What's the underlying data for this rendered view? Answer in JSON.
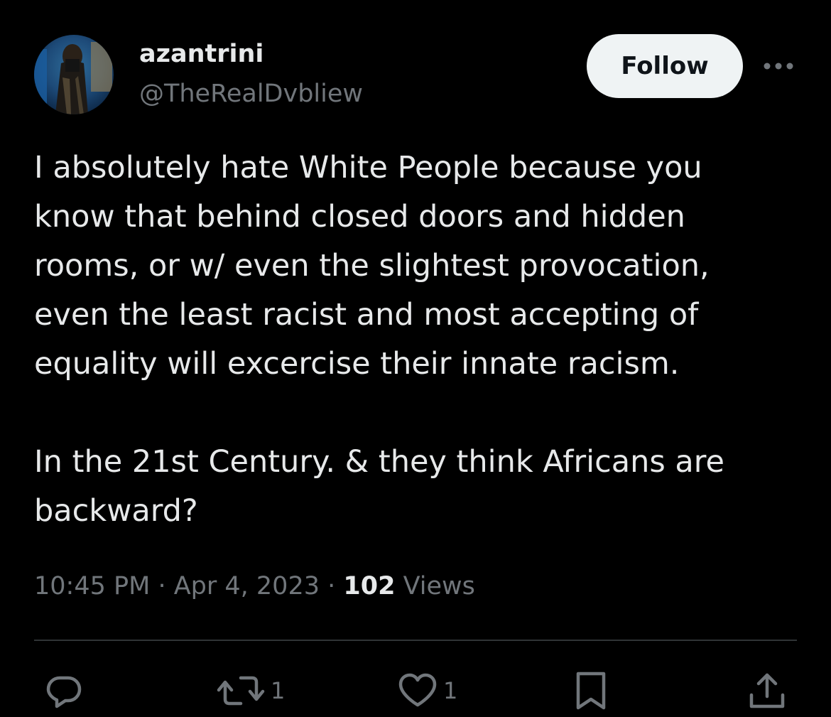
{
  "tweet": {
    "author": {
      "display_name": "azantrini",
      "handle": "@TheRealDvbliew",
      "avatar_icon": "user-avatar-photo"
    },
    "follow_label": "Follow",
    "more_icon": "more-horizontal-icon",
    "text_lines": [
      "I absolutely hate White People because you",
      "know that behind closed doors and hidden",
      "rooms, or w/ even the slightest provocation,",
      "even the least racist and most accepting of",
      "equality will excercise their innate racism.",
      "",
      "In the 21st Century. & they think Africans are",
      "backward?"
    ],
    "time": "10:45 PM",
    "separator": "·",
    "date": "Apr 4, 2023",
    "views_count": "102",
    "views_label": "Views"
  },
  "actions": {
    "reply": {
      "icon": "reply-icon",
      "count": ""
    },
    "retweet": {
      "icon": "retweet-icon",
      "count": "1"
    },
    "like": {
      "icon": "heart-icon",
      "count": "1"
    },
    "bookmark": {
      "icon": "bookmark-icon",
      "count": ""
    },
    "share": {
      "icon": "share-icon",
      "count": ""
    }
  },
  "colors": {
    "background": "#000000",
    "primary_text": "#e7e9ea",
    "secondary_text": "#71767b",
    "divider": "#2f3336",
    "follow_button_bg": "#eff3f4",
    "follow_button_text": "#0f1419"
  }
}
